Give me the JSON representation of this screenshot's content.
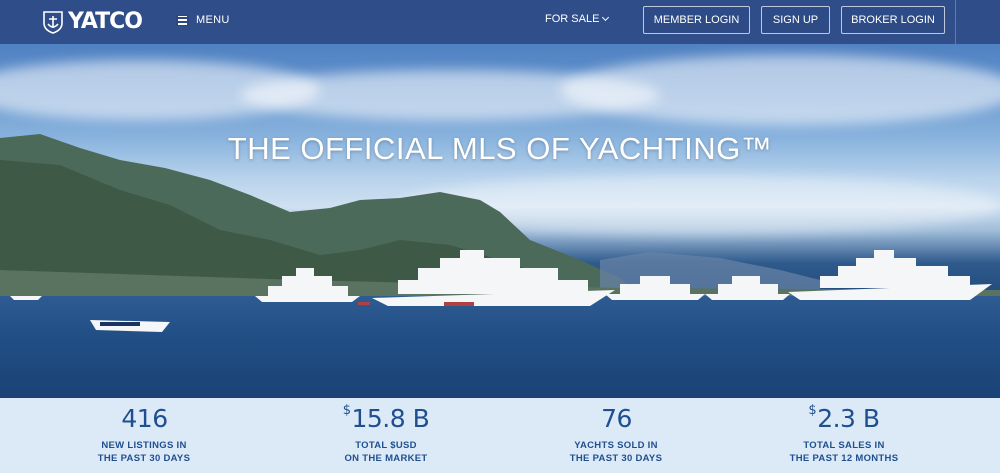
{
  "nav": {
    "logo_text": "YATCO",
    "menu_label": "MENU",
    "for_sale_label": "FOR SALE",
    "member_login_label": "MEMBER LOGIN",
    "sign_up_label": "SIGN UP",
    "broker_login_label": "BROKER LOGIN"
  },
  "hero": {
    "title": "THE OFFICIAL MLS OF YACHTING™"
  },
  "stats": [
    {
      "currency": "",
      "value": "416",
      "label_line1": "NEW LISTINGS IN",
      "label_line2": "THE PAST 30 DAYS"
    },
    {
      "currency": "$",
      "value": "15.8 B",
      "label_line1": "TOTAL $USD",
      "label_line2": "ON THE MARKET"
    },
    {
      "currency": "",
      "value": "76",
      "label_line1": "YACHTS SOLD IN",
      "label_line2": "THE PAST 30 DAYS"
    },
    {
      "currency": "$",
      "value": "2.3 B",
      "label_line1": "TOTAL SALES IN",
      "label_line2": "THE PAST 12 MONTHS"
    }
  ],
  "colors": {
    "nav_bg": "#2c4882",
    "stats_bg": "#dceaf8",
    "stats_text": "#1f4f8f"
  }
}
